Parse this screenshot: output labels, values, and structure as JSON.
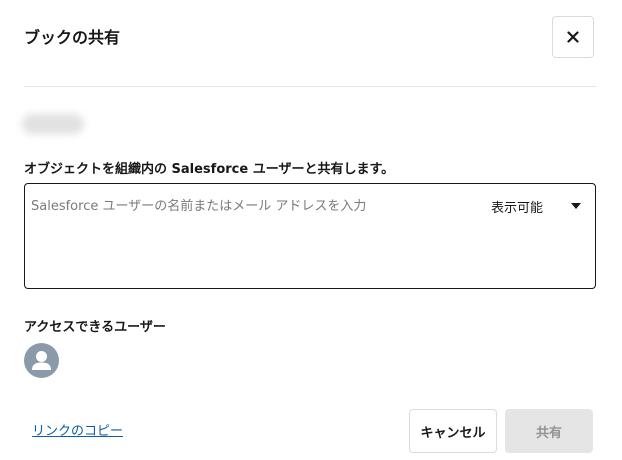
{
  "dialog": {
    "title": "ブックの共有",
    "close_icon": "close-icon"
  },
  "share": {
    "label": "オブジェクトを組織内の Salesforce ユーザーと共有します。",
    "placeholder": "Salesforce ユーザーの名前またはメール アドレスを入力",
    "value": "",
    "permission": {
      "selected": "表示可能",
      "icon": "caret-down-icon"
    }
  },
  "access": {
    "label": "アクセスできるユーザー",
    "users": [
      {
        "avatar_icon": "user-icon"
      }
    ]
  },
  "footer": {
    "copy_link_label": "リンクのコピー",
    "cancel_label": "キャンセル",
    "share_label": "共有"
  },
  "colors": {
    "link": "#0b5cab",
    "avatar_bg": "#8a9aab",
    "disabled_button_bg": "#e5e5e5",
    "disabled_button_text": "#939393",
    "border": "#dddbda"
  }
}
